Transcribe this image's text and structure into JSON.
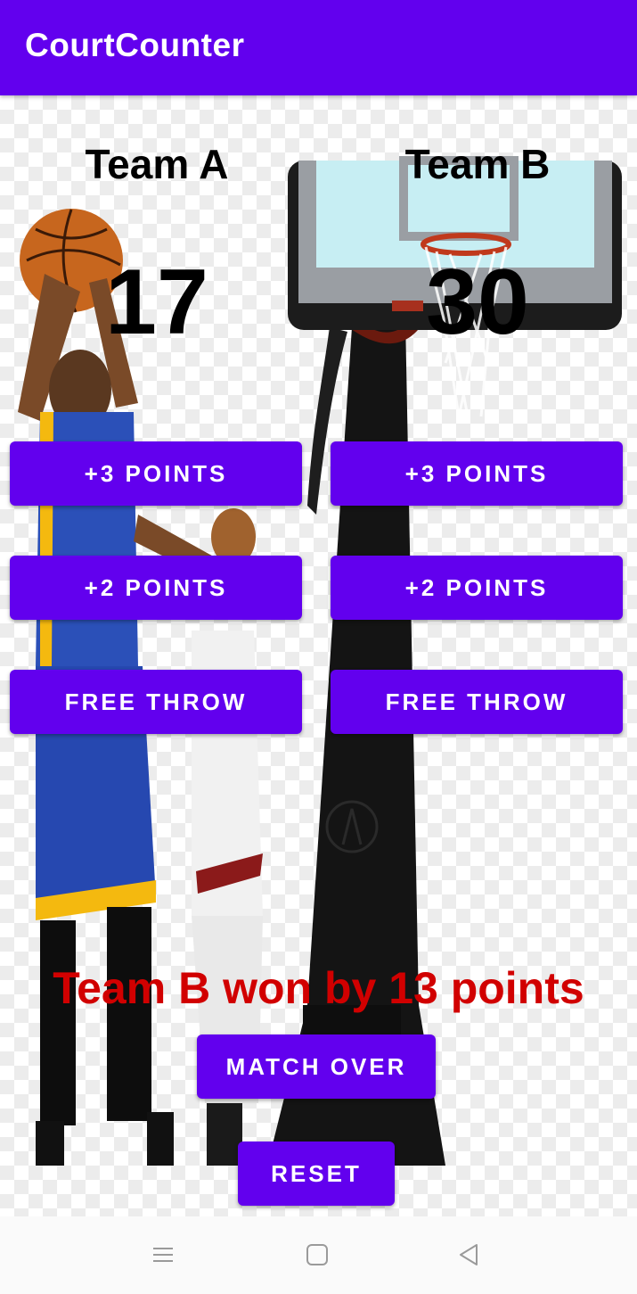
{
  "app_bar": {
    "title": "CourtCounter",
    "color": "#6200ee"
  },
  "team_a": {
    "name": "Team A",
    "score": "17",
    "buttons": {
      "three": "+3 POINTS",
      "two": "+2 POINTS",
      "free": "FREE THROW"
    }
  },
  "team_b": {
    "name": "Team B",
    "score": "30",
    "buttons": {
      "three": "+3 POINTS",
      "two": "+2 POINTS",
      "free": "FREE THROW"
    }
  },
  "result": {
    "text": "Team B won by 13 points",
    "color": "#d10000"
  },
  "actions": {
    "match_over": "MATCH OVER",
    "reset": "RESET"
  },
  "nav": {
    "icons": [
      "menu-icon",
      "home-square-icon",
      "back-triangle-icon"
    ]
  }
}
